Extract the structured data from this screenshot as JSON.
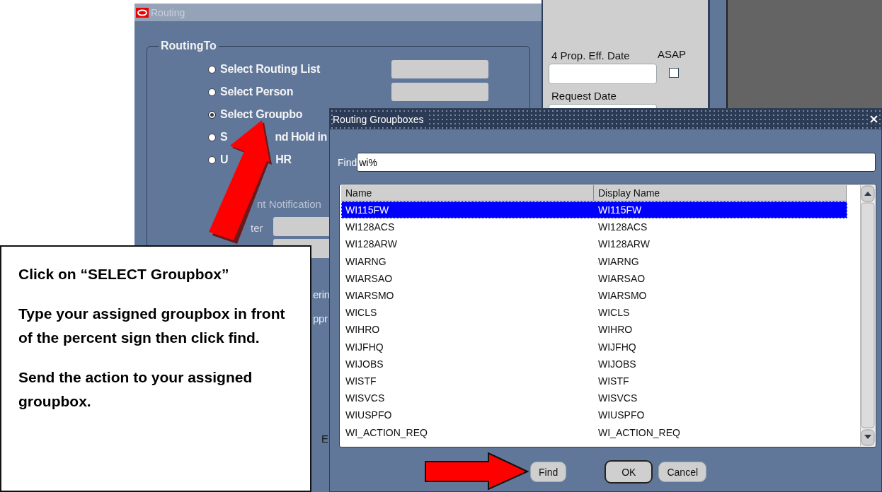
{
  "routing_window": {
    "title": "Routing",
    "group_label": "RoutingTo",
    "options": [
      {
        "label": "Select Routing List",
        "selected": false,
        "has_field": true
      },
      {
        "label": "Select Person",
        "selected": false,
        "has_field": true
      },
      {
        "label": "Select Groupbo",
        "selected": true,
        "has_field": false
      },
      {
        "label": "S",
        "tail": "nd Hold in",
        "selected": false,
        "has_field": false
      },
      {
        "label": "U",
        "tail": "HR",
        "selected": false,
        "has_field": false
      }
    ],
    "notification_label": "nt Notification",
    "recipient_label": "ter",
    "covered_texts": [
      "erin",
      "ppr"
    ],
    "covered_button": "E"
  },
  "side_panel": {
    "date_label": "4 Prop. Eff. Date",
    "asap_label": "ASAP",
    "asap_checked": false,
    "request_label": "Request Date"
  },
  "dialog": {
    "title": "Routing Groupboxes",
    "find_label": "Find",
    "find_value": "wi%",
    "columns": [
      "Name",
      "Display Name"
    ],
    "rows": [
      {
        "name": "WI115FW",
        "display_name": "WI115FW",
        "selected": true
      },
      {
        "name": "WI128ACS",
        "display_name": "WI128ACS",
        "selected": false
      },
      {
        "name": "WI128ARW",
        "display_name": "WI128ARW",
        "selected": false
      },
      {
        "name": "WIARNG",
        "display_name": "WIARNG",
        "selected": false
      },
      {
        "name": "WIARSAO",
        "display_name": "WIARSAO",
        "selected": false
      },
      {
        "name": "WIARSMO",
        "display_name": "WIARSMO",
        "selected": false
      },
      {
        "name": "WICLS",
        "display_name": "WICLS",
        "selected": false
      },
      {
        "name": "WIHRO",
        "display_name": "WIHRO",
        "selected": false
      },
      {
        "name": "WIJFHQ",
        "display_name": "WIJFHQ",
        "selected": false
      },
      {
        "name": "WIJOBS",
        "display_name": "WIJOBS",
        "selected": false
      },
      {
        "name": "WISTF",
        "display_name": "WISTF",
        "selected": false
      },
      {
        "name": "WISVCS",
        "display_name": "WISVCS",
        "selected": false
      },
      {
        "name": "WIUSPFO",
        "display_name": "WIUSPFO",
        "selected": false
      },
      {
        "name": "WI_ACTION_REQ",
        "display_name": "WI_ACTION_REQ",
        "selected": false
      }
    ],
    "buttons": [
      {
        "label": "Find",
        "default": false
      },
      {
        "label": "OK",
        "default": true
      },
      {
        "label": "Cancel",
        "default": false
      }
    ]
  },
  "callout": {
    "paragraphs": [
      "Click on “SELECT Groupbox”",
      "Type your assigned groupbox in front of the percent sign then click find.",
      "Send the action to your assigned groupbox."
    ]
  }
}
